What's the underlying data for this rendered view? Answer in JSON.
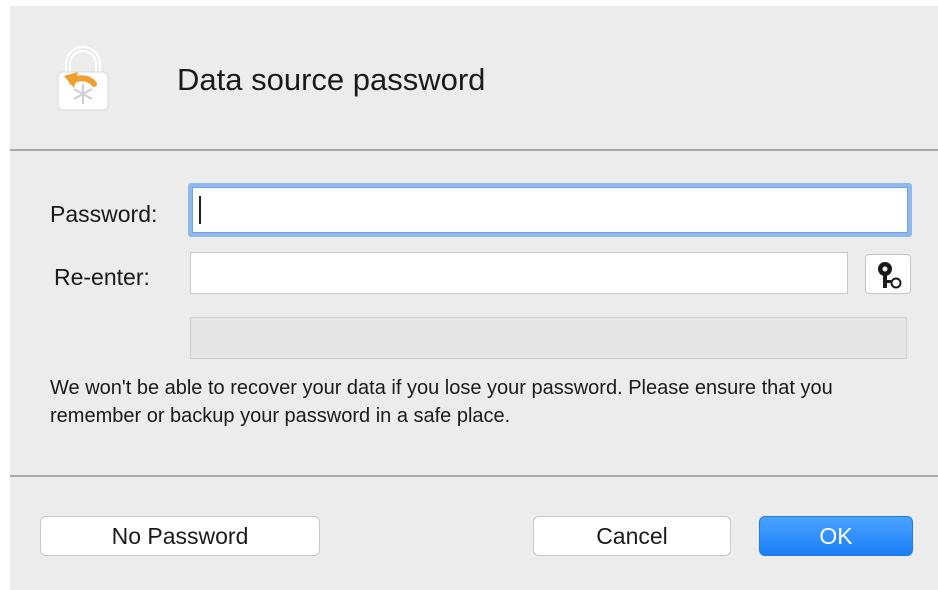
{
  "dialog": {
    "title": "Data source password",
    "icon": "lock-restore-icon"
  },
  "form": {
    "password_label": "Password:",
    "password_value": "",
    "reenter_label": "Re-enter:",
    "reenter_value": "",
    "key_button_icon": "key-icon",
    "strength": 0
  },
  "warning_text": "We won't be able to recover your data if you lose your password. Please ensure that you remember or backup your password in a safe place.",
  "buttons": {
    "no_password": "No Password",
    "cancel": "Cancel",
    "ok": "OK"
  },
  "colors": {
    "accent": "#1a7ef7",
    "focus_ring": "#8fb9ec",
    "icon_arrow": "#f0a030"
  }
}
